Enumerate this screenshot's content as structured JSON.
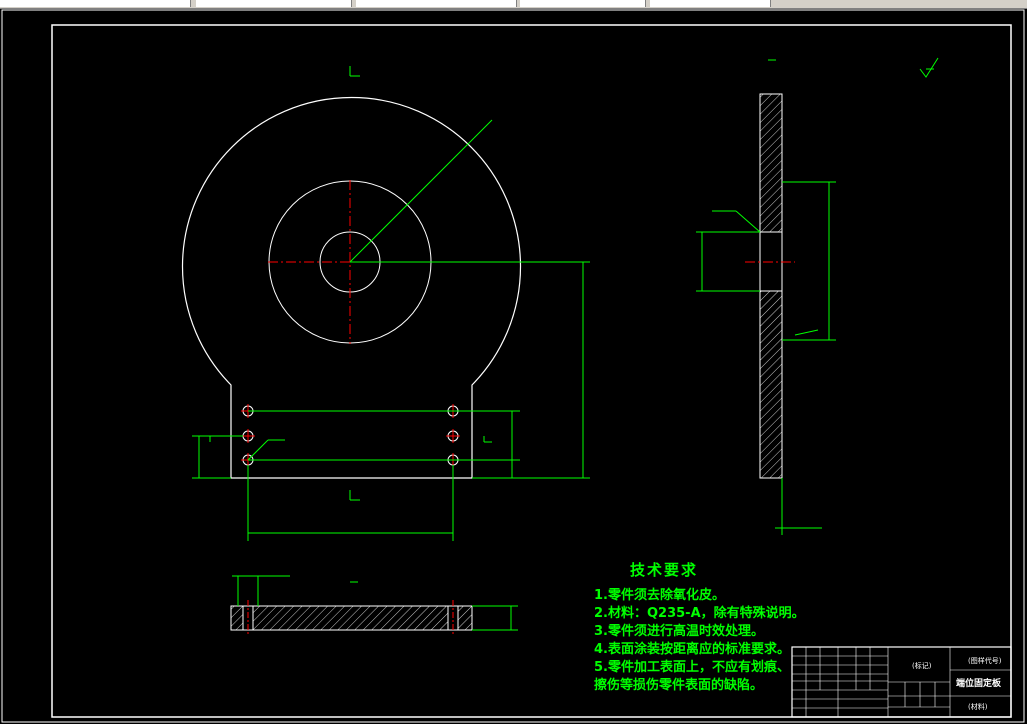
{
  "drawing": {
    "title_block": {
      "part_name": "端位固定板",
      "left_mark": "(标记)",
      "right_mark": "(图样代号)",
      "material": "(材料)"
    },
    "technical_requirements": {
      "title": "技术要求",
      "items": [
        "1.零件须去除氧化皮。",
        "2.材料：Q235-A，除有特殊说明。",
        "3.零件须进行高温时效处理。",
        "4.表面涂装按距离应的标准要求。",
        "5.零件加工表面上，不应有划痕、",
        "擦伤等损伤零件表面的缺陷。"
      ]
    },
    "colors": {
      "outline": "#ffffff",
      "dimension": "#00ff00",
      "centerline": "#ff0000",
      "border": "#ffffff",
      "background": "#000000"
    }
  }
}
